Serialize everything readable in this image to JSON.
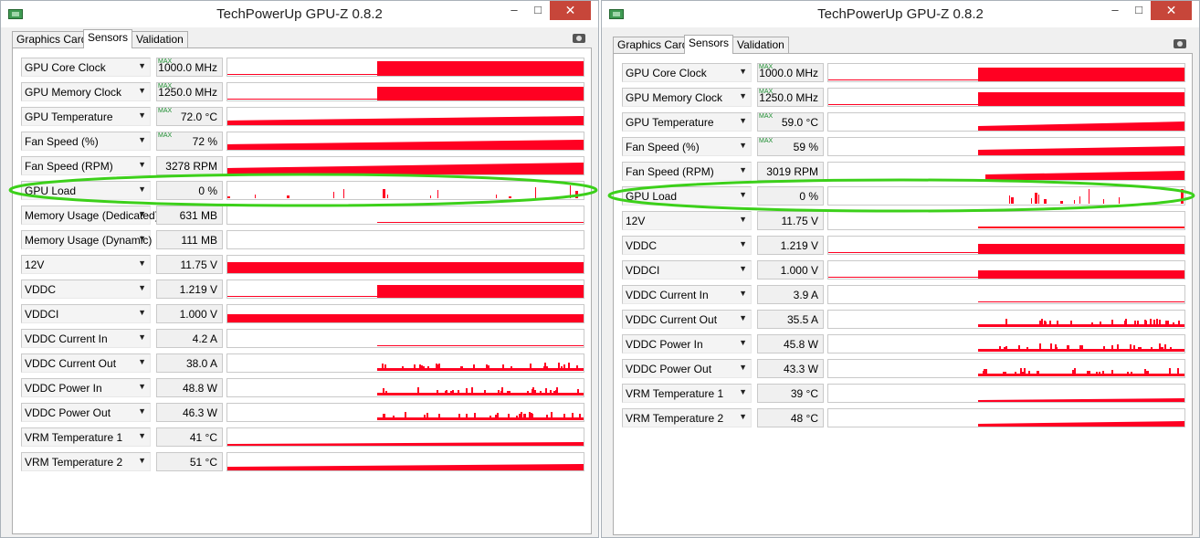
{
  "windows": [
    {
      "id": "left",
      "title": "TechPowerUp GPU-Z 0.8.2",
      "controls": {
        "min": "–",
        "max": "□",
        "close": "✕"
      },
      "tabs": [
        "Graphics Card",
        "Sensors",
        "Validation"
      ],
      "active_tab": "Sensors",
      "highlighted_row": "GPU Load",
      "sensors": [
        {
          "label": "GPU Core Clock",
          "value": "1000.0 MHz",
          "max": true,
          "graph": "step",
          "level": 0.85,
          "onset": 0.42
        },
        {
          "label": "GPU Memory Clock",
          "value": "1250.0 MHz",
          "max": true,
          "graph": "step",
          "level": 0.8,
          "onset": 0.42
        },
        {
          "label": "GPU Temperature",
          "value": "72.0 °C",
          "max": true,
          "graph": "ramp",
          "level": 0.5,
          "onset": 0.0
        },
        {
          "label": "Fan Speed (%)",
          "value": "72 %",
          "max": true,
          "graph": "ramp",
          "level": 0.6,
          "onset": 0.0
        },
        {
          "label": "Fan Speed (RPM)",
          "value": "3278 RPM",
          "max": false,
          "graph": "ramp",
          "level": 0.7,
          "onset": 0.0
        },
        {
          "label": "GPU Load",
          "value": "0 %",
          "max": false,
          "graph": "spikes",
          "level": 0.9,
          "onset": 0.0
        },
        {
          "label": "Memory Usage (Dedicated)",
          "value": "631 MB",
          "max": false,
          "graph": "line",
          "level": 0.2,
          "onset": 0.42
        },
        {
          "label": "Memory Usage (Dynamic)",
          "value": "111 MB",
          "max": false,
          "graph": "empty",
          "level": 0.0,
          "onset": 0.0
        },
        {
          "label": "12V",
          "value": "11.75 V",
          "max": false,
          "graph": "full",
          "level": 0.65,
          "onset": 0.0
        },
        {
          "label": "VDDC",
          "value": "1.219 V",
          "max": false,
          "graph": "step",
          "level": 0.75,
          "onset": 0.42
        },
        {
          "label": "VDDCI",
          "value": "1.000 V",
          "max": false,
          "graph": "full",
          "level": 0.45,
          "onset": 0.0
        },
        {
          "label": "VDDC Current In",
          "value": "4.2 A",
          "max": false,
          "graph": "line",
          "level": 0.1,
          "onset": 0.42
        },
        {
          "label": "VDDC Current Out",
          "value": "38.0 A",
          "max": false,
          "graph": "noise",
          "level": 0.3,
          "onset": 0.42
        },
        {
          "label": "VDDC Power In",
          "value": "48.8 W",
          "max": false,
          "graph": "noise",
          "level": 0.3,
          "onset": 0.42
        },
        {
          "label": "VDDC Power Out",
          "value": "46.3 W",
          "max": false,
          "graph": "noise",
          "level": 0.3,
          "onset": 0.42
        },
        {
          "label": "VRM Temperature 1",
          "value": "41 °C",
          "max": false,
          "graph": "ramp",
          "level": 0.2,
          "onset": 0.0
        },
        {
          "label": "VRM Temperature 2",
          "value": "51 °C",
          "max": false,
          "graph": "ramp",
          "level": 0.35,
          "onset": 0.0
        }
      ]
    },
    {
      "id": "right",
      "title": "TechPowerUp GPU-Z 0.8.2",
      "controls": {
        "min": "–",
        "max": "□",
        "close": "✕"
      },
      "tabs": [
        "Graphics Card",
        "Sensors",
        "Validation"
      ],
      "active_tab": "Sensors",
      "highlighted_row": "GPU Load",
      "sensors": [
        {
          "label": "GPU Core Clock",
          "value": "1000.0 MHz",
          "max": true,
          "graph": "step",
          "level": 0.8,
          "onset": 0.42
        },
        {
          "label": "GPU Memory Clock",
          "value": "1250.0 MHz",
          "max": true,
          "graph": "step",
          "level": 0.8,
          "onset": 0.42
        },
        {
          "label": "GPU Temperature",
          "value": "59.0 °C",
          "max": true,
          "graph": "ramp",
          "level": 0.5,
          "onset": 0.42
        },
        {
          "label": "Fan Speed (%)",
          "value": "59 %",
          "max": true,
          "graph": "ramp",
          "level": 0.55,
          "onset": 0.42
        },
        {
          "label": "Fan Speed (RPM)",
          "value": "3019 RPM",
          "max": false,
          "graph": "ramp",
          "level": 0.55,
          "onset": 0.44
        },
        {
          "label": "GPU Load",
          "value": "0 %",
          "max": false,
          "graph": "spikes",
          "level": 0.9,
          "onset": 0.5
        },
        {
          "label": "12V",
          "value": "11.75 V",
          "max": false,
          "graph": "line",
          "level": 0.4,
          "onset": 0.42
        },
        {
          "label": "VDDC",
          "value": "1.219 V",
          "max": false,
          "graph": "step",
          "level": 0.6,
          "onset": 0.42
        },
        {
          "label": "VDDCI",
          "value": "1.000 V",
          "max": false,
          "graph": "step",
          "level": 0.45,
          "onset": 0.42
        },
        {
          "label": "VDDC Current In",
          "value": "3.9 A",
          "max": false,
          "graph": "line",
          "level": 0.1,
          "onset": 0.42
        },
        {
          "label": "VDDC Current Out",
          "value": "35.5 A",
          "max": false,
          "graph": "noise",
          "level": 0.3,
          "onset": 0.42
        },
        {
          "label": "VDDC Power In",
          "value": "45.8 W",
          "max": false,
          "graph": "noise",
          "level": 0.3,
          "onset": 0.42
        },
        {
          "label": "VDDC Power Out",
          "value": "43.3 W",
          "max": false,
          "graph": "noise",
          "level": 0.3,
          "onset": 0.42
        },
        {
          "label": "VRM Temperature 1",
          "value": "39 °C",
          "max": false,
          "graph": "ramp",
          "level": 0.2,
          "onset": 0.42
        },
        {
          "label": "VRM Temperature 2",
          "value": "48 °C",
          "max": false,
          "graph": "ramp",
          "level": 0.3,
          "onset": 0.42
        }
      ]
    }
  ],
  "max_tag": "MAX",
  "dropdown_arrow": "▼",
  "colors": {
    "graph_fill": "#ff0022",
    "highlight_ellipse": "#3cd01a",
    "max_tag": "#1f8f32",
    "close_button": "#c7463a"
  },
  "icons": [
    "gpu-z-app-icon",
    "camera-icon",
    "chevron-down-icon"
  ]
}
